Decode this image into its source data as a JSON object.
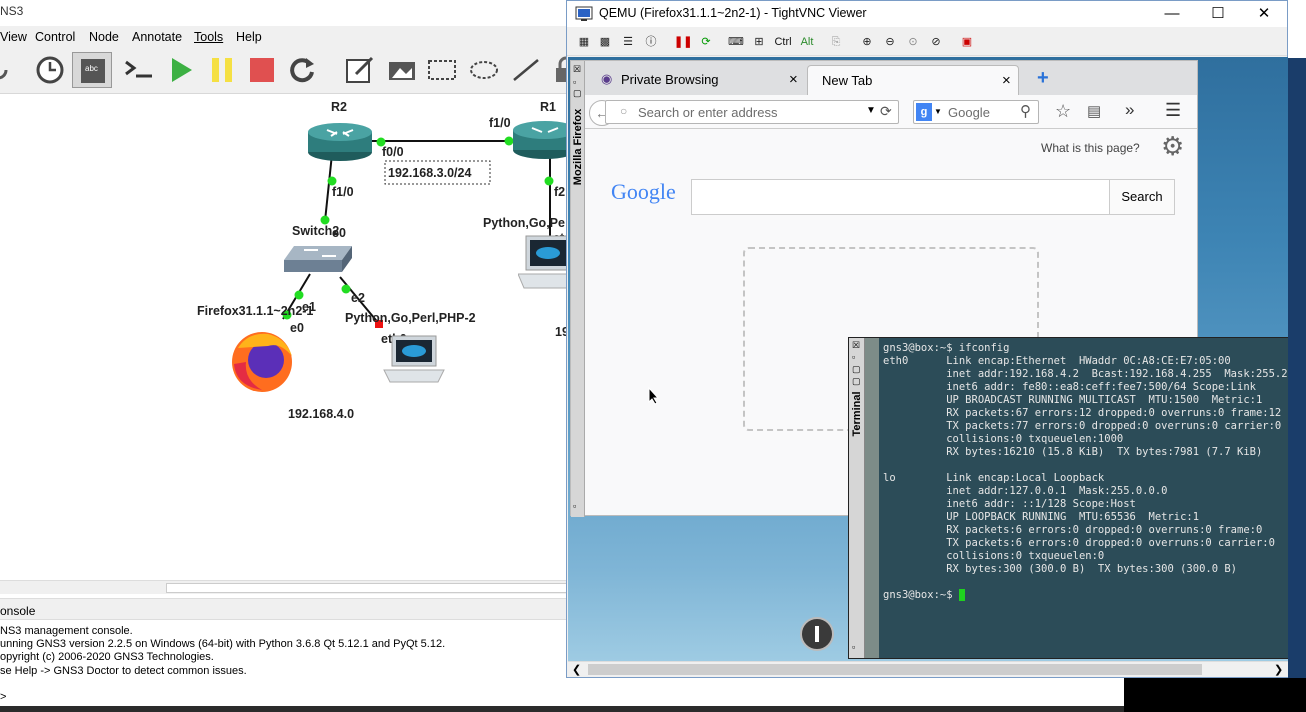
{
  "gns3": {
    "title_fragment": "NS3",
    "menu": [
      "View",
      "Control",
      "Node",
      "Annotate",
      "Tools",
      "Help"
    ],
    "nodes": {
      "r2": "R2",
      "r1": "R1",
      "switch": "Switch2",
      "firefox": "Firefox31.1.1~2n2-1",
      "python": "Python,Go,Perl,PHP-2",
      "python_r": "Python,Go,Pe"
    },
    "links": {
      "r2_f00": "f0/0",
      "r1_f10": "f1/0",
      "r2_f10": "f1/0",
      "r1_f2": "f2",
      "sw_e0": "e0",
      "sw_e1": "e1",
      "sw_e2": "e2",
      "ff_e0": "e0",
      "py_eth0": "eth0",
      "py_r_eth": "et"
    },
    "networks": {
      "net1": "192.168.3.0/24",
      "net2": "192.168.4.0",
      "net3_fragment": "19"
    },
    "console": {
      "header": "onsole",
      "lines": [
        "NS3 management console.",
        "unning GNS3 version 2.2.5 on Windows (64-bit) with Python 3.6.8 Qt 5.12.1 and PyQt 5.12.",
        "opyright (c) 2006-2020 GNS3 Technologies.",
        "se Help -> GNS3 Doctor to detect common issues.",
        "",
        ">"
      ]
    }
  },
  "vnc": {
    "title": "QEMU (Firefox31.1.1~2n2-1) - TightVNC Viewer",
    "toolbar": [
      "Ctrl",
      "Alt"
    ],
    "controls": {
      "minimize": "—",
      "maximize": "☐",
      "close": "✕"
    }
  },
  "firefox": {
    "side_label": "Mozilla Firefox",
    "tabs": [
      {
        "label": "Private Browsing",
        "close": "×"
      },
      {
        "label": "New Tab",
        "close": "×"
      }
    ],
    "new_tab": "+",
    "url_placeholder": "Search or enter address",
    "search_engine": "Google",
    "what_is": "What is this page?",
    "logo": "Google",
    "search_button": "Search"
  },
  "terminal": {
    "side_label": "Terminal",
    "lines": [
      "gns3@box:~$ ifconfig",
      "eth0      Link encap:Ethernet  HWaddr 0C:A8:CE:E7:05:00",
      "          inet addr:192.168.4.2  Bcast:192.168.4.255  Mask:255.255.255.0",
      "          inet6 addr: fe80::ea8:ceff:fee7:500/64 Scope:Link",
      "          UP BROADCAST RUNNING MULTICAST  MTU:1500  Metric:1",
      "          RX packets:67 errors:12 dropped:0 overruns:0 frame:12",
      "          TX packets:77 errors:0 dropped:0 overruns:0 carrier:0",
      "          collisions:0 txqueuelen:1000",
      "          RX bytes:16210 (15.8 KiB)  TX bytes:7981 (7.7 KiB)",
      "",
      "lo        Link encap:Local Loopback",
      "          inet addr:127.0.0.1  Mask:255.0.0.0",
      "          inet6 addr: ::1/128 Scope:Host",
      "          UP LOOPBACK RUNNING  MTU:65536  Metric:1",
      "          RX packets:6 errors:0 dropped:0 overruns:0 frame:0",
      "          TX packets:6 errors:0 dropped:0 overruns:0 carrier:0",
      "          collisions:0 txqueuelen:0",
      "          RX bytes:300 (300.0 B)  TX bytes:300 (300.0 B)",
      ""
    ],
    "prompt": "gns3@box:~$ "
  },
  "colors": {
    "router": "#2e7d7d",
    "link_dot": "#22dd22",
    "link_dot_red": "#ee1111",
    "terminal_bg": "#2c4c58",
    "cursor": "#1fd11f"
  }
}
